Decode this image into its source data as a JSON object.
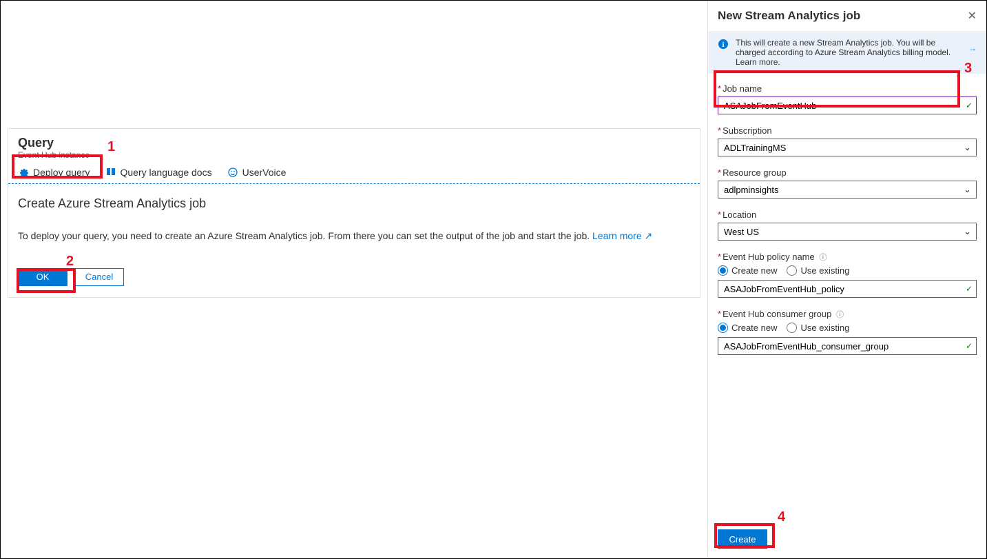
{
  "main": {
    "title": "Query",
    "subtitle": "Event Hub instance",
    "toolbar": {
      "deploy": "Deploy query",
      "docs": "Query language docs",
      "uservoice": "UserVoice"
    },
    "section_title": "Create Azure Stream Analytics job",
    "section_text": "To deploy your query, you need to create an Azure Stream Analytics job. From there you can set the output of the job and start the job. ",
    "learn_more": "Learn more",
    "ok": "OK",
    "cancel": "Cancel"
  },
  "pane": {
    "title": "New Stream Analytics job",
    "banner_text": "This will create a new Stream Analytics job. You will be charged according to Azure Stream Analytics billing model. Learn more.",
    "fields": {
      "job_name_label": "Job name",
      "job_name_value": "ASAJobFromEventHub",
      "subscription_label": "Subscription",
      "subscription_value": "ADLTrainingMS",
      "rg_label": "Resource group",
      "rg_value": "adlpminsights",
      "location_label": "Location",
      "location_value": "West US",
      "policy_label": "Event Hub policy name",
      "policy_value": "ASAJobFromEventHub_policy",
      "consumer_label": "Event Hub consumer group",
      "consumer_value": "ASAJobFromEventHub_consumer_group",
      "radio_create": "Create new",
      "radio_existing": "Use existing"
    },
    "create": "Create"
  },
  "annotations": {
    "n1": "1",
    "n2": "2",
    "n3": "3",
    "n4": "4"
  }
}
